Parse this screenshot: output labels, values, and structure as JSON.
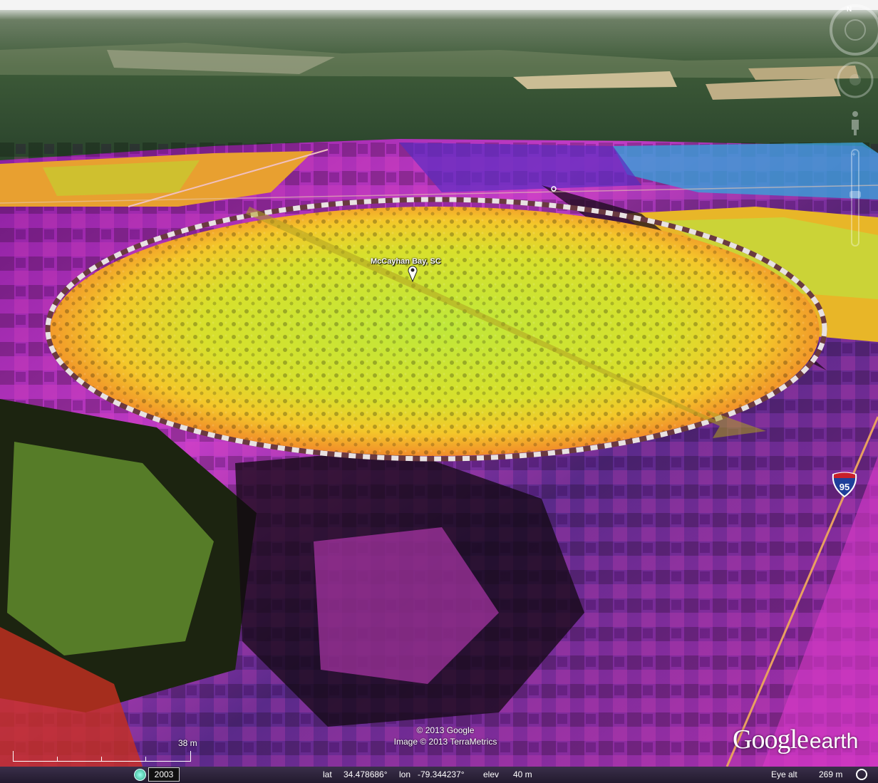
{
  "placemark": {
    "label": "McCayhan Bay, SC"
  },
  "road_shield": {
    "number": "95",
    "text": "INTERSTATE"
  },
  "copyright": {
    "line1": "© 2013 Google",
    "line2": "Image © 2013 TerraMetrics"
  },
  "logo": {
    "google": "Google",
    "earth": "earth"
  },
  "scale": {
    "label": "38 m"
  },
  "nav": {
    "north_label": "N"
  },
  "status_bar": {
    "imagery_year": "2003",
    "lat_label": "lat",
    "lat_value": "34.478686°",
    "lon_label": "lon",
    "lon_value": "-79.344237°",
    "elev_label": "elev",
    "elev_value": "40 m",
    "eye_alt_label": "Eye alt",
    "eye_alt_value": "269 m"
  },
  "colors": {
    "sky": "#ffffff",
    "far_terrain": "#3f5a3a",
    "bay_center": "#b8e63a",
    "bay_rim": "#ffb020",
    "outer_magenta": "#c838c8",
    "highway": "#e8a060"
  }
}
